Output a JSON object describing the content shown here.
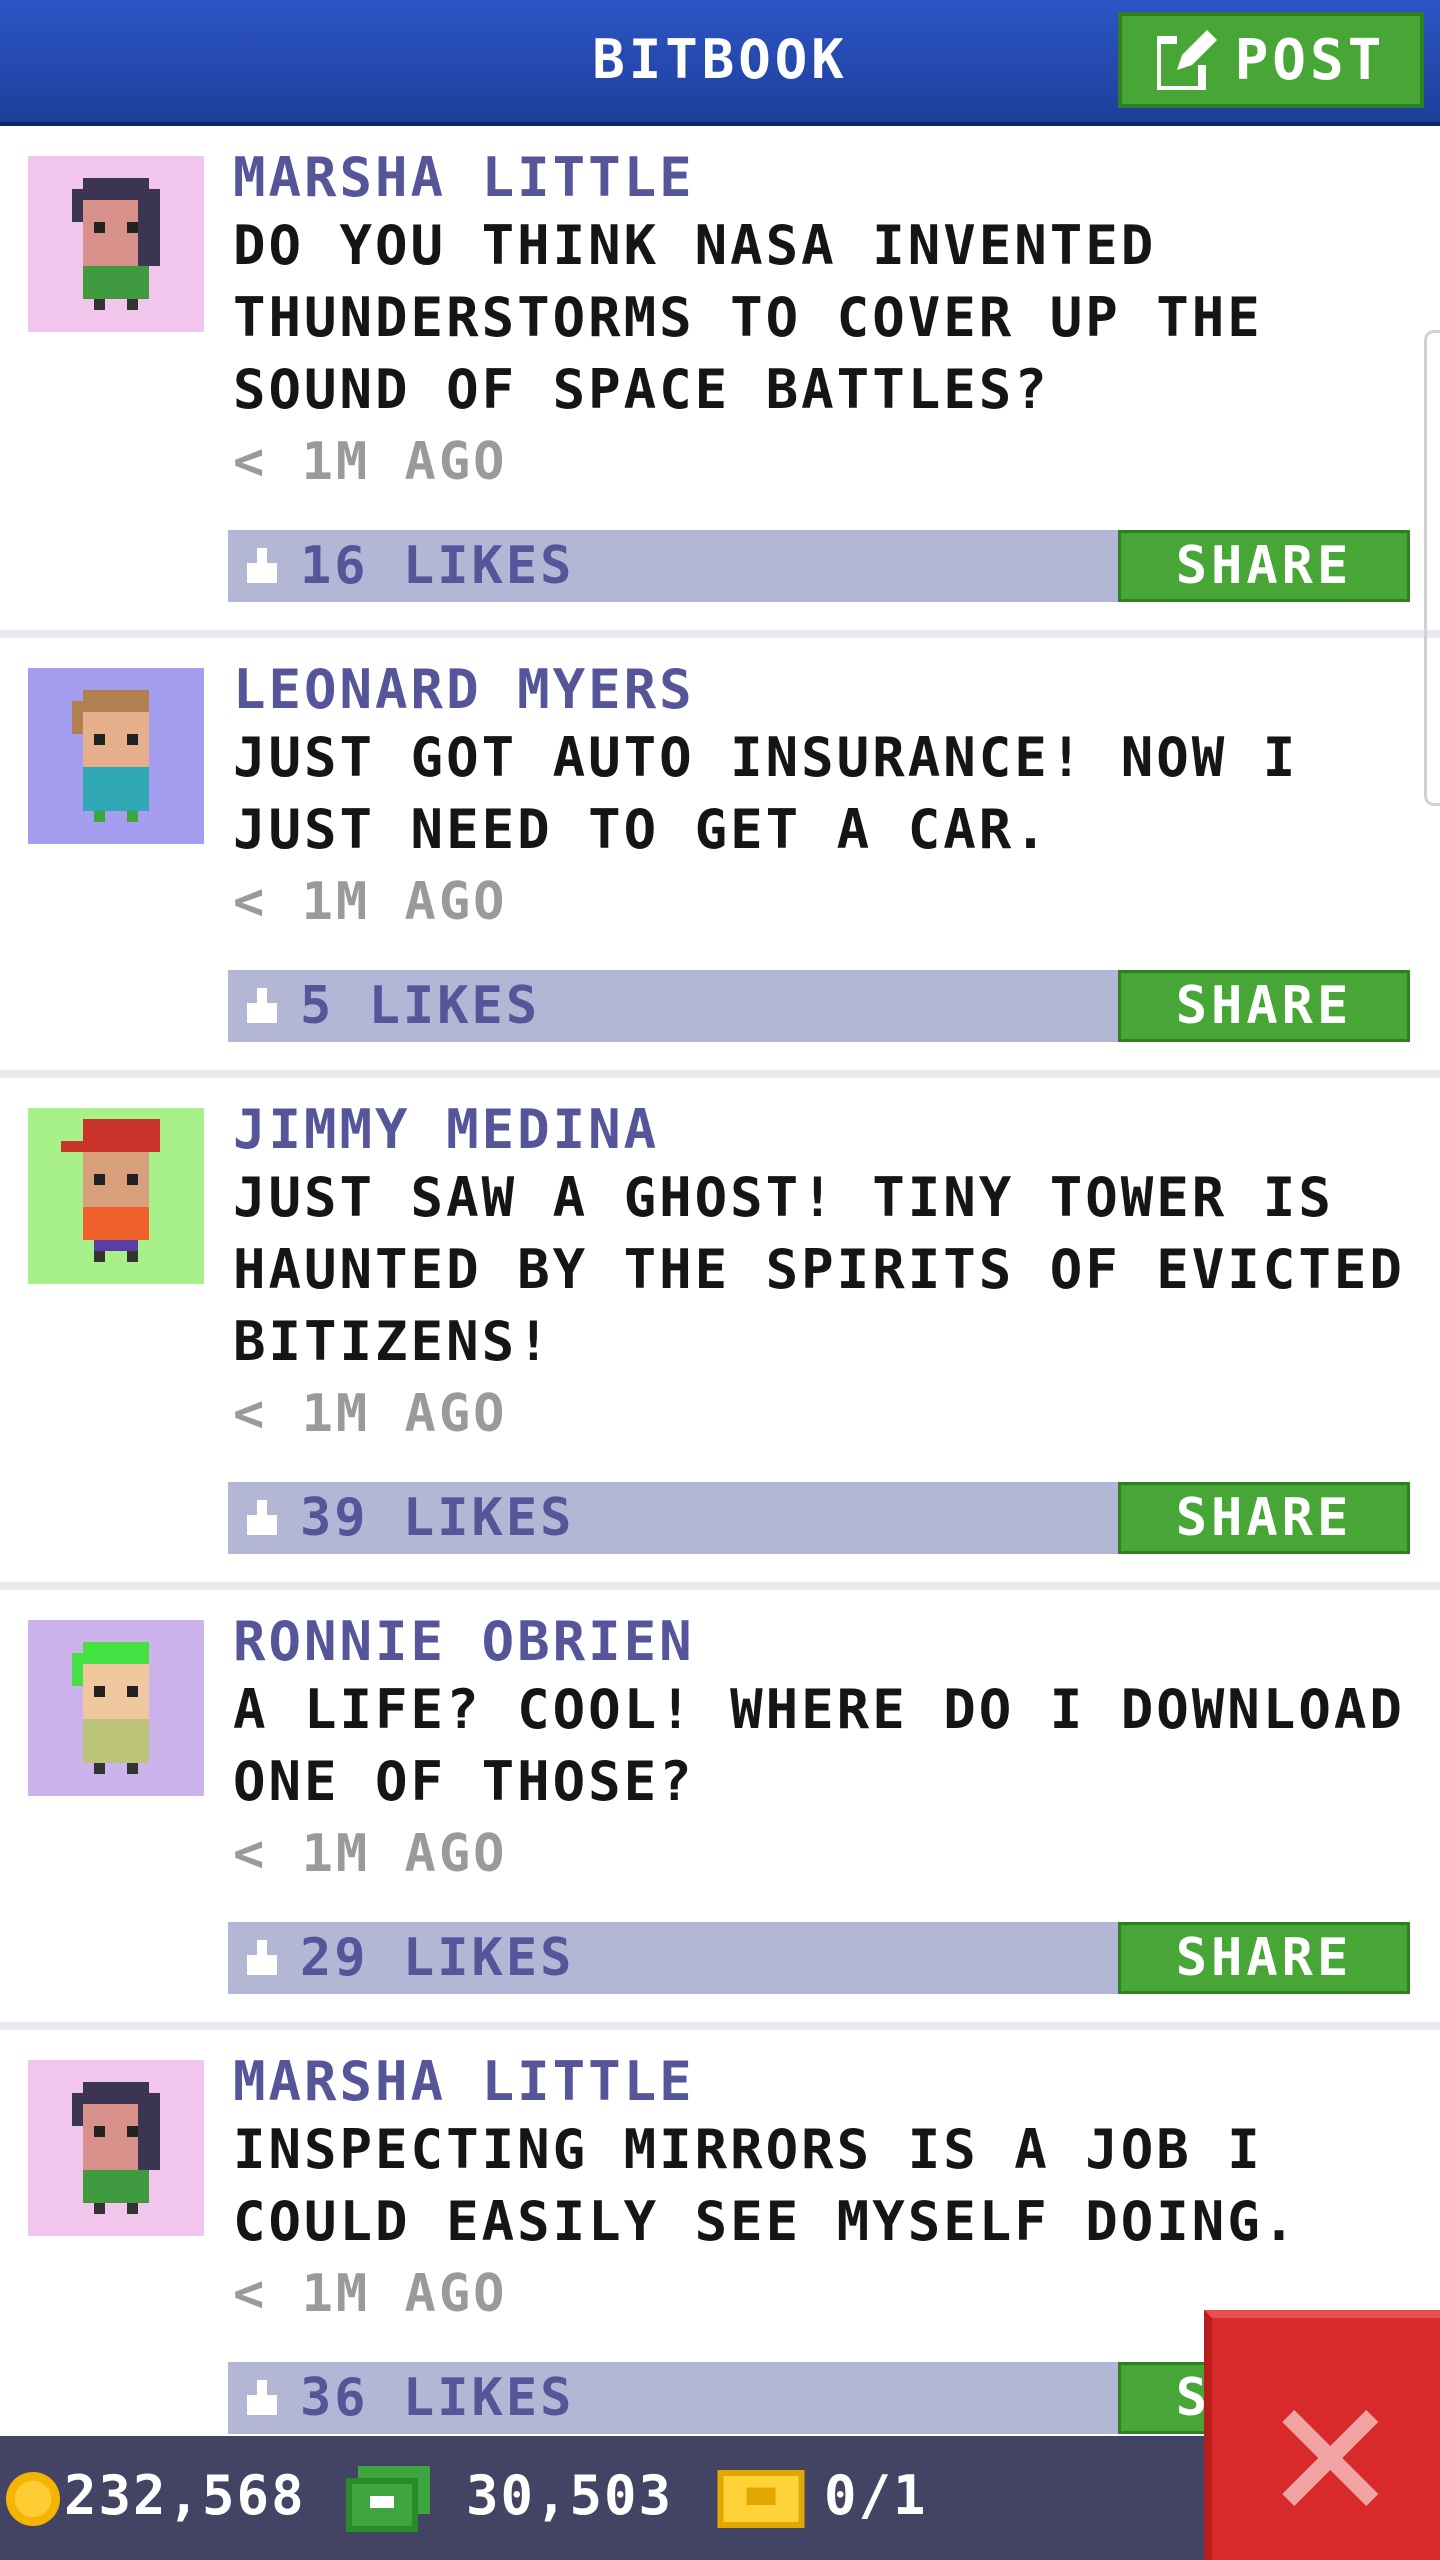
{
  "header": {
    "title": "BITBOOK",
    "post_label": "POST"
  },
  "posts": [
    {
      "author": "MARSHA LITTLE",
      "text": "DO YOU THINK NASA INVENTED THUNDERSTORMS TO COVER UP THE SOUND OF SPACE BATTLES?",
      "time": "< 1M AGO",
      "likes": "16 LIKES",
      "share_label": "SHARE"
    },
    {
      "author": "LEONARD MYERS",
      "text": "JUST GOT AUTO INSURANCE! NOW I JUST NEED TO GET A CAR.",
      "time": "< 1M AGO",
      "likes": "5 LIKES",
      "share_label": "SHARE"
    },
    {
      "author": "JIMMY MEDINA",
      "text": "JUST SAW A GHOST! TINY TOWER IS HAUNTED BY THE SPIRITS OF EVICTED BITIZENS!",
      "time": "< 1M AGO",
      "likes": "39 LIKES",
      "share_label": "SHARE"
    },
    {
      "author": "RONNIE OBRIEN",
      "text": "A LIFE? COOL! WHERE DO I DOWNLOAD ONE OF THOSE?",
      "time": "< 1M AGO",
      "likes": "29 LIKES",
      "share_label": "SHARE"
    },
    {
      "author": "MARSHA LITTLE",
      "text": "INSPECTING MIRRORS IS A JOB I COULD EASILY SEE MYSELF DOING.",
      "time": "< 1M AGO",
      "likes": "36 LIKES",
      "share_label": "SHARE"
    }
  ],
  "footer": {
    "coins": "232,568",
    "bux": "30,503",
    "tickets": "0/1"
  },
  "colors": {
    "header_blue": "#2d55c6",
    "share_green": "#48a636",
    "like_bar": "#b4b6d6",
    "close_red": "#d82a2a"
  },
  "icons": {
    "post": "edit-icon",
    "like": "thumbs-up-icon",
    "coins": "coin-icon",
    "bux": "bux-icon",
    "tickets": "ticket-icon",
    "close": "close-icon"
  }
}
